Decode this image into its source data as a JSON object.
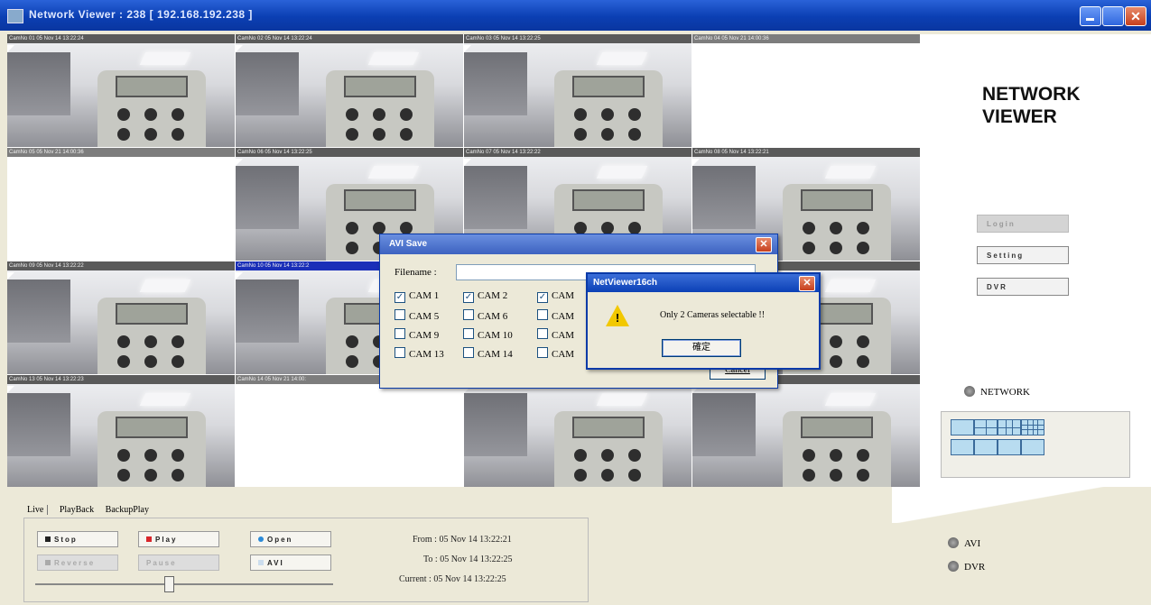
{
  "window": {
    "title": "Network Viewer : 238 [ 192.168.192.238 ]",
    "close_glyph": "✕"
  },
  "cameras": [
    {
      "label": "CamNo 01 05 Nov 14 13:22:24"
    },
    {
      "label": "CamNo 02 05 Nov 14 13:22:24"
    },
    {
      "label": "CamNo 03 05 Nov 14 13:22:25"
    },
    {
      "label": "CamNo 04 05 Nov 21 14:00:36"
    },
    {
      "label": "CamNo 05 05 Nov 21 14:00:36"
    },
    {
      "label": "CamNo 06 05 Nov 14 13:22:25"
    },
    {
      "label": "CamNo 07 05 Nov 14 13:22:22"
    },
    {
      "label": "CamNo 08 05 Nov 14 13:22:21"
    },
    {
      "label": "CamNo 09 05 Nov 14 13:22:22"
    },
    {
      "label": "CamNo 10 05 Nov 14 13:22:2"
    },
    {
      "label": ""
    },
    {
      "label": "14 13:22:22"
    },
    {
      "label": "CamNo 13 05 Nov 14 13:22:23"
    },
    {
      "label": "CamNo 14 05 Nov 21 14:00:"
    },
    {
      "label": ""
    },
    {
      "label": "14 13:22:24"
    }
  ],
  "avi_dialog": {
    "title": "AVI Save",
    "filename_label": "Filename :",
    "filename_value": "",
    "cancel_label": "Cancel",
    "close_glyph": "✕",
    "cams": [
      {
        "label": "CAM 1",
        "checked": "✓"
      },
      {
        "label": "CAM 2",
        "checked": "✓"
      },
      {
        "label": "CAM",
        "checked": "✓"
      },
      {
        "label": "CAM 5",
        "checked": ""
      },
      {
        "label": "CAM 6",
        "checked": ""
      },
      {
        "label": "CAM",
        "checked": ""
      },
      {
        "label": "CAM 9",
        "checked": ""
      },
      {
        "label": "CAM 10",
        "checked": ""
      },
      {
        "label": "CAM",
        "checked": ""
      },
      {
        "label": "CAM 13",
        "checked": ""
      },
      {
        "label": "CAM 14",
        "checked": ""
      },
      {
        "label": "CAM",
        "checked": ""
      }
    ]
  },
  "message_box": {
    "title": "NetViewer16ch",
    "message": "Only 2 Cameras selectable !!",
    "ok_label": "確定",
    "warn_glyph": "!",
    "close_glyph": "✕"
  },
  "side_panel": {
    "brand_line1": "NETWORK",
    "brand_line2": "VIEWER",
    "login_label": "Login",
    "setting_label": "Setting",
    "dvr_label": "DVR",
    "network_label": "NETWORK"
  },
  "bottom": {
    "tabs": [
      "Live",
      "PlayBack",
      "BackupPlay"
    ],
    "stop_label": "Stop",
    "play_label": "Play",
    "open_label": "Open",
    "reverse_label": "Reverse",
    "pause_label": "Pause",
    "avi_btn_label": "AVI",
    "from_text": "From : 05 Nov 14 13:22:21",
    "to_text": "To : 05 Nov 14 13:22:25",
    "current_text": "Current : 05 Nov 14 13:22:25",
    "opt_avi": "AVI",
    "opt_dvr": "DVR"
  },
  "colors": {
    "titlebar": "#0b3fb3",
    "selected_cam": "#1a2fb8",
    "play_accent": "#d8262a",
    "open_accent": "#2a8ad8"
  }
}
